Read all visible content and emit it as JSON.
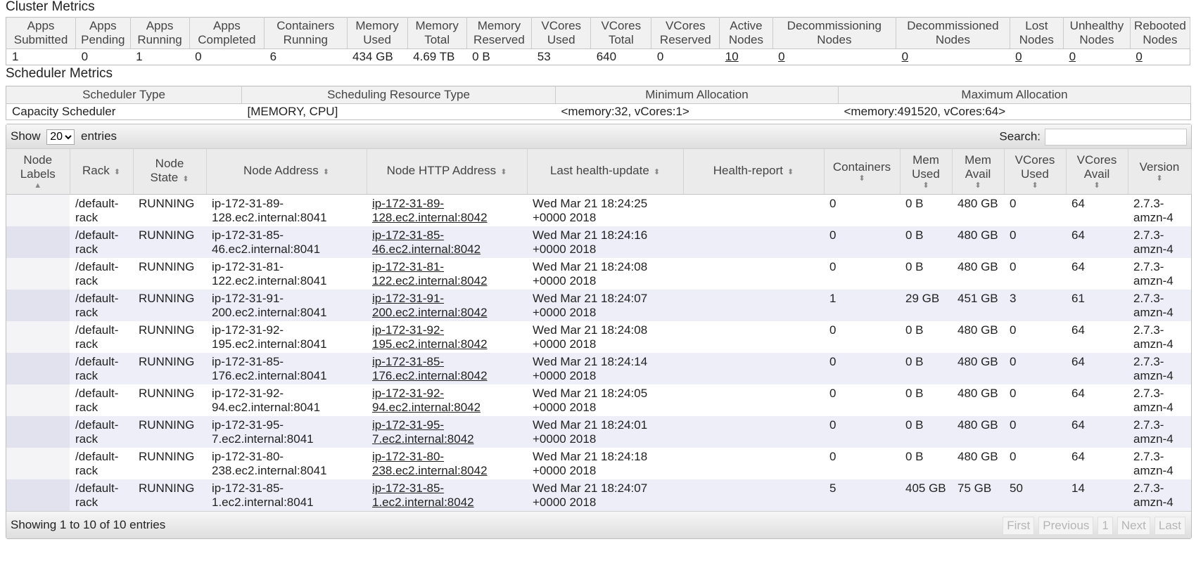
{
  "cluster": {
    "title": "Cluster Metrics",
    "headers": [
      "Apps Submitted",
      "Apps Pending",
      "Apps Running",
      "Apps Completed",
      "Containers Running",
      "Memory Used",
      "Memory Total",
      "Memory Reserved",
      "VCores Used",
      "VCores Total",
      "VCores Reserved",
      "Active Nodes",
      "Decommissioning Nodes",
      "Decommissioned Nodes",
      "Lost Nodes",
      "Unhealthy Nodes",
      "Rebooted Nodes"
    ],
    "values": [
      "1",
      "0",
      "1",
      "0",
      "6",
      "434 GB",
      "4.69 TB",
      "0 B",
      "53",
      "640",
      "0",
      "10",
      "0",
      "0",
      "0",
      "0",
      "0"
    ]
  },
  "scheduler": {
    "title": "Scheduler Metrics",
    "headers": [
      "Scheduler Type",
      "Scheduling Resource Type",
      "Minimum Allocation",
      "Maximum Allocation"
    ],
    "values": [
      "Capacity Scheduler",
      "[MEMORY, CPU]",
      "<memory:32, vCores:1>",
      "<memory:491520, vCores:64>"
    ]
  },
  "toolbar": {
    "show_label": "Show",
    "entries_label": "entries",
    "page_size": "20",
    "search_label": "Search:",
    "search_value": ""
  },
  "nodes": {
    "headers": [
      "Node Labels",
      "Rack",
      "Node State",
      "Node Address",
      "Node HTTP Address",
      "Last health-update",
      "Health-report",
      "Containers",
      "Mem Used",
      "Mem Avail",
      "VCores Used",
      "VCores Avail",
      "Version"
    ],
    "rows": [
      [
        "",
        "/default-rack",
        "RUNNING",
        "ip-172-31-89-128.ec2.internal:8041",
        "ip-172-31-89-128.ec2.internal:8042",
        "Wed Mar 21 18:24:25 +0000 2018",
        "",
        "0",
        "0 B",
        "480 GB",
        "0",
        "64",
        "2.7.3-amzn-4"
      ],
      [
        "",
        "/default-rack",
        "RUNNING",
        "ip-172-31-85-46.ec2.internal:8041",
        "ip-172-31-85-46.ec2.internal:8042",
        "Wed Mar 21 18:24:16 +0000 2018",
        "",
        "0",
        "0 B",
        "480 GB",
        "0",
        "64",
        "2.7.3-amzn-4"
      ],
      [
        "",
        "/default-rack",
        "RUNNING",
        "ip-172-31-81-122.ec2.internal:8041",
        "ip-172-31-81-122.ec2.internal:8042",
        "Wed Mar 21 18:24:08 +0000 2018",
        "",
        "0",
        "0 B",
        "480 GB",
        "0",
        "64",
        "2.7.3-amzn-4"
      ],
      [
        "",
        "/default-rack",
        "RUNNING",
        "ip-172-31-91-200.ec2.internal:8041",
        "ip-172-31-91-200.ec2.internal:8042",
        "Wed Mar 21 18:24:07 +0000 2018",
        "",
        "1",
        "29 GB",
        "451 GB",
        "3",
        "61",
        "2.7.3-amzn-4"
      ],
      [
        "",
        "/default-rack",
        "RUNNING",
        "ip-172-31-92-195.ec2.internal:8041",
        "ip-172-31-92-195.ec2.internal:8042",
        "Wed Mar 21 18:24:08 +0000 2018",
        "",
        "0",
        "0 B",
        "480 GB",
        "0",
        "64",
        "2.7.3-amzn-4"
      ],
      [
        "",
        "/default-rack",
        "RUNNING",
        "ip-172-31-85-176.ec2.internal:8041",
        "ip-172-31-85-176.ec2.internal:8042",
        "Wed Mar 21 18:24:14 +0000 2018",
        "",
        "0",
        "0 B",
        "480 GB",
        "0",
        "64",
        "2.7.3-amzn-4"
      ],
      [
        "",
        "/default-rack",
        "RUNNING",
        "ip-172-31-92-94.ec2.internal:8041",
        "ip-172-31-92-94.ec2.internal:8042",
        "Wed Mar 21 18:24:05 +0000 2018",
        "",
        "0",
        "0 B",
        "480 GB",
        "0",
        "64",
        "2.7.3-amzn-4"
      ],
      [
        "",
        "/default-rack",
        "RUNNING",
        "ip-172-31-95-7.ec2.internal:8041",
        "ip-172-31-95-7.ec2.internal:8042",
        "Wed Mar 21 18:24:01 +0000 2018",
        "",
        "0",
        "0 B",
        "480 GB",
        "0",
        "64",
        "2.7.3-amzn-4"
      ],
      [
        "",
        "/default-rack",
        "RUNNING",
        "ip-172-31-80-238.ec2.internal:8041",
        "ip-172-31-80-238.ec2.internal:8042",
        "Wed Mar 21 18:24:18 +0000 2018",
        "",
        "0",
        "0 B",
        "480 GB",
        "0",
        "64",
        "2.7.3-amzn-4"
      ],
      [
        "",
        "/default-rack",
        "RUNNING",
        "ip-172-31-85-1.ec2.internal:8041",
        "ip-172-31-85-1.ec2.internal:8042",
        "Wed Mar 21 18:24:07 +0000 2018",
        "",
        "5",
        "405 GB",
        "75 GB",
        "50",
        "14",
        "2.7.3-amzn-4"
      ]
    ]
  },
  "footer": {
    "info": "Showing 1 to 10 of 10 entries",
    "pager": [
      "First",
      "Previous",
      "1",
      "Next",
      "Last"
    ]
  }
}
